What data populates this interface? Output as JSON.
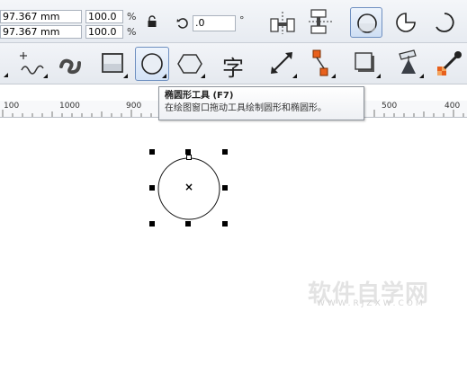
{
  "property_bar": {
    "width_value": "97.367 mm",
    "height_value": "97.367 mm",
    "scale_x": "100.0",
    "scale_y": "100.0",
    "percent_symbol": "%",
    "rotation_value": ".0",
    "degree_symbol": "°",
    "icons": [
      "lock-ratio-icon",
      "rotate-icon",
      "mirror-horizontal-icon",
      "mirror-vertical-icon",
      "ellipse-mode-icon",
      "pie-mode-icon",
      "arc-mode-icon"
    ]
  },
  "toolbox": {
    "tools": [
      {
        "name": "freehand-tool",
        "active": false
      },
      {
        "name": "artistic-media-tool",
        "active": false
      },
      {
        "name": "rectangle-tool",
        "active": false
      },
      {
        "name": "ellipse-tool",
        "active": true
      },
      {
        "name": "polygon-tool",
        "active": false
      },
      {
        "name": "text-tool",
        "glyph": "字",
        "active": false
      },
      {
        "name": "dimension-tool",
        "active": false
      },
      {
        "name": "connector-tool",
        "active": false
      },
      {
        "name": "drop-shadow-tool",
        "active": false
      },
      {
        "name": "fill-tool",
        "active": false
      },
      {
        "name": "eyedropper-tool",
        "active": false
      }
    ]
  },
  "tooltip": {
    "title": "椭圆形工具 (F7)",
    "description": "在绘图窗口拖动工具绘制圆形和椭圆形。"
  },
  "ruler": {
    "labels": [
      "100",
      "1000",
      "900",
      "500",
      "400"
    ]
  },
  "canvas": {
    "shape": "circle",
    "center_marker": "×"
  },
  "watermark": {
    "text": "软件自学网",
    "sub": "WWW.RJZXW.COM"
  }
}
